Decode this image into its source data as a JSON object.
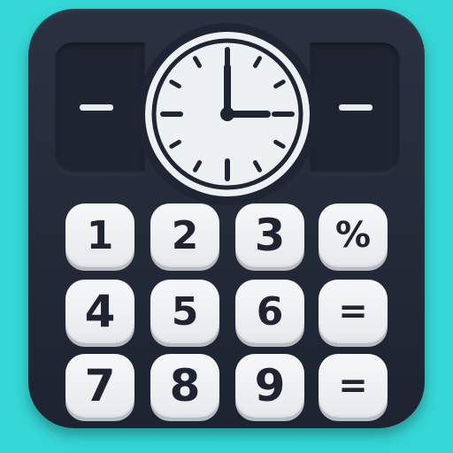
{
  "icon": {
    "screen_left_symbol": "–",
    "screen_right_symbol": "–",
    "clock": {
      "hour_hand": "3 o'clock",
      "minute_hand": "12"
    }
  },
  "keypad": {
    "row1": [
      "1",
      "2",
      "3",
      "%"
    ],
    "row2": [
      "4",
      "5",
      "6",
      "="
    ],
    "row3": [
      "7",
      "8",
      "9",
      "="
    ]
  },
  "colors": {
    "background": "#35d6d6",
    "body": "#252c3a",
    "key_face": "#f1f2f4",
    "ink": "#1f2430"
  }
}
